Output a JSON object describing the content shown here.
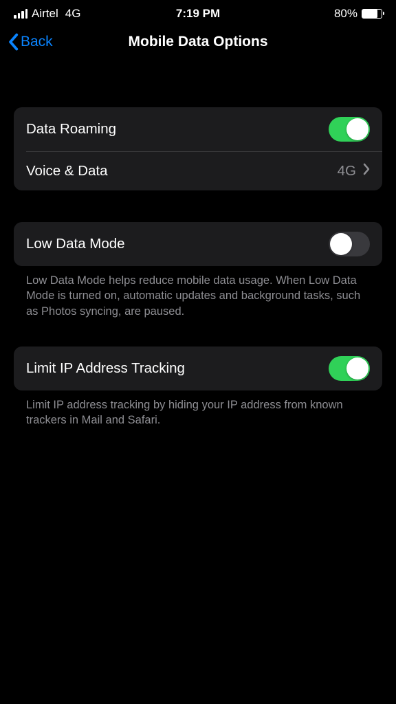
{
  "status": {
    "carrier": "Airtel",
    "network": "4G",
    "time": "7:19 PM",
    "battery_pct": "80%",
    "battery_fill_pct": 80
  },
  "nav": {
    "back_label": "Back",
    "title": "Mobile Data Options"
  },
  "sections": {
    "data_roaming": {
      "label": "Data Roaming",
      "on": true
    },
    "voice_data": {
      "label": "Voice & Data",
      "value": "4G"
    },
    "low_data": {
      "label": "Low Data Mode",
      "on": false,
      "footer": "Low Data Mode helps reduce mobile data usage. When Low Data Mode is turned on, automatic updates and background tasks, such as Photos syncing, are paused."
    },
    "limit_ip": {
      "label": "Limit IP Address Tracking",
      "on": true,
      "footer": "Limit IP address tracking by hiding your IP address from known trackers in Mail and Safari."
    }
  }
}
